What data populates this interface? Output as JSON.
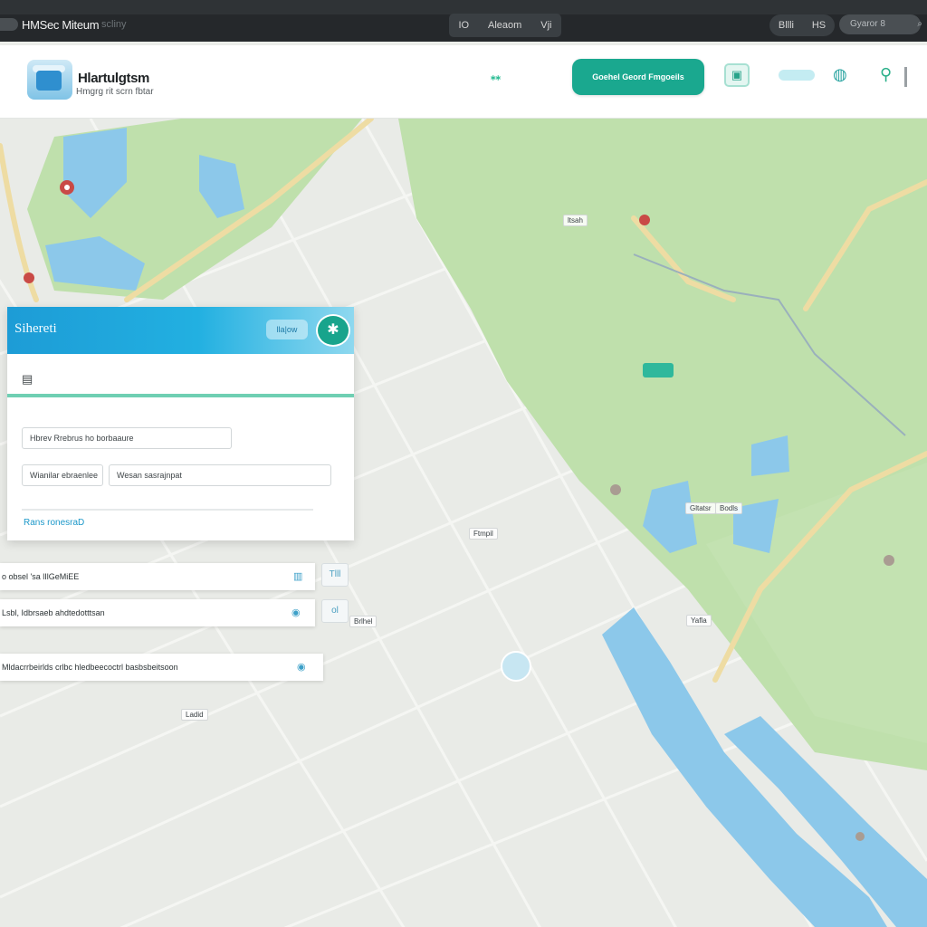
{
  "window": {
    "title": "HMSec Miteum",
    "subtitle": "scliny",
    "center_controls": [
      "IO",
      "Aleaom",
      "Vji"
    ],
    "right_controls": [
      "Bllli",
      "HS"
    ],
    "search_placeholder": "Gyaror 8",
    "search_icon": "search-icon"
  },
  "header": {
    "brand_title": "Hlartulgtsm",
    "brand_tagline": "Hmgrg rit scrn fbtar",
    "nav_item": "⁎⁎",
    "cta_label": "Goehel Geord Fmgoeils",
    "icons": [
      "map-square-icon",
      "globe-icon",
      "plug-icon"
    ]
  },
  "panel": {
    "title": "Sihereti",
    "chip": "lla|ow",
    "round_icon": "settings-icon",
    "sub_icon": "filter-icon",
    "search_value": "Hbrev Rrebrus ho borbaaure",
    "field_left": "Wianilar ebraenlee",
    "field_right": "Wesan sasrajnpat",
    "link": "Rans ronesraD"
  },
  "results": [
    {
      "label": "o obsel 'sa lIlGeMiEE",
      "side": "Tlll"
    },
    {
      "label": "Lsbl, Idbrsaeb ahdtedotttsan",
      "side": "ol"
    },
    {
      "label": "Mldacrrbeirlds crlbc hledbeecoctrl basbsbeitsoon",
      "side": ""
    }
  ],
  "map": {
    "colors": {
      "land": "#e9ebe7",
      "park": "#bfe0ac",
      "water": "#8cc8ea",
      "road": "#eedca3",
      "pin": "#c94a46"
    },
    "labels": [
      "ltsah",
      "Ftmpil",
      "Gltatsr",
      "Bodls",
      "Yafla",
      "Brlhel",
      "Ladid"
    ]
  }
}
